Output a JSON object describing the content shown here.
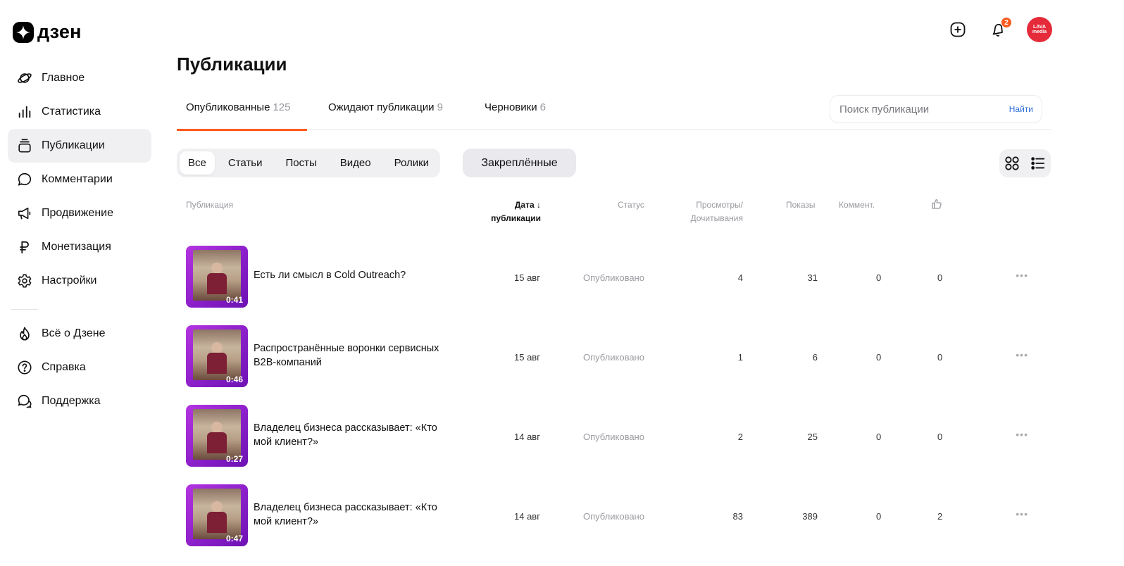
{
  "brand": {
    "name": "дзен"
  },
  "sidebar": {
    "items": [
      {
        "label": "Главное",
        "icon": "planet-icon"
      },
      {
        "label": "Статистика",
        "icon": "bar-chart-icon"
      },
      {
        "label": "Публикации",
        "icon": "stack-icon",
        "active": true
      },
      {
        "label": "Комментарии",
        "icon": "comment-icon"
      },
      {
        "label": "Продвижение",
        "icon": "megaphone-icon"
      },
      {
        "label": "Монетизация",
        "icon": "ruble-icon"
      },
      {
        "label": "Настройки",
        "icon": "gear-icon"
      }
    ],
    "secondary": [
      {
        "label": "Всё о Дзене",
        "icon": "flame-icon"
      },
      {
        "label": "Справка",
        "icon": "question-icon"
      },
      {
        "label": "Поддержка",
        "icon": "support-chat-icon"
      }
    ]
  },
  "header": {
    "notifications_count": "2",
    "avatar_text": "LAVA media"
  },
  "page": {
    "title": "Публикации"
  },
  "tabs": [
    {
      "label": "Опубликованные",
      "count": "125",
      "active": true
    },
    {
      "label": "Ожидают публикации",
      "count": "9"
    },
    {
      "label": "Черновики",
      "count": "6"
    }
  ],
  "search": {
    "placeholder": "Поиск публикации",
    "button": "Найти"
  },
  "filters": {
    "chips": [
      "Все",
      "Статьи",
      "Посты",
      "Видео",
      "Ролики"
    ],
    "active": "Все",
    "pinned": "Закреплённые"
  },
  "table": {
    "headers": {
      "publication": "Публикация",
      "date_line1": "Дата",
      "date_line2": "публикации",
      "status": "Статус",
      "views_line1": "Просмотры/",
      "views_line2": "Дочитывания",
      "shows": "Показы",
      "comments": "Коммент.",
      "likes_icon": "thumbs-up-icon"
    },
    "rows": [
      {
        "duration": "0:41",
        "title": "Есть ли смысл в Cold Outreach?",
        "date": "15 авг",
        "status": "Опубликовано",
        "views": "4",
        "shows": "31",
        "comments": "0",
        "likes": "0"
      },
      {
        "duration": "0:46",
        "title": "Распространённые воронки сервисных B2B-компаний",
        "date": "15 авг",
        "status": "Опубликовано",
        "views": "1",
        "shows": "6",
        "comments": "0",
        "likes": "0"
      },
      {
        "duration": "0:27",
        "title": "Владелец бизнеса рассказывает: «Кто мой клиент?»",
        "date": "14 авг",
        "status": "Опубликовано",
        "views": "2",
        "shows": "25",
        "comments": "0",
        "likes": "0"
      },
      {
        "duration": "0:47",
        "title": "Владелец бизнеса рассказывает: «Кто мой клиент?»",
        "date": "14 авг",
        "status": "Опубликовано",
        "views": "83",
        "shows": "389",
        "comments": "0",
        "likes": "2"
      }
    ]
  },
  "colors": {
    "accent": "#ff5a1f",
    "link": "#2b6ed8",
    "avatar": "#e52a3a",
    "thumb": "#9b2ad6"
  }
}
